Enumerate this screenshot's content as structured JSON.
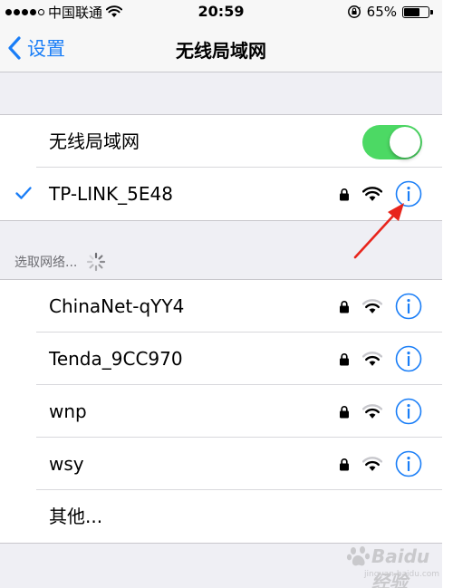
{
  "status_bar": {
    "carrier": "中国联通",
    "time": "20:59",
    "battery": "65%",
    "battery_level": 0.65,
    "signal_bars_filled": 4,
    "signal_bars_total": 5
  },
  "nav": {
    "back_label": "设置",
    "title": "无线局域网"
  },
  "wifi_toggle": {
    "label": "无线局域网",
    "on": true
  },
  "connected_network": {
    "name": "TP-LINK_5E48",
    "secured": true
  },
  "section_header": "选取网络...",
  "networks": [
    {
      "name": "ChinaNet-qYY4",
      "secured": true
    },
    {
      "name": "Tenda_9CC970",
      "secured": true
    },
    {
      "name": "wnp",
      "secured": true
    },
    {
      "name": "wsy",
      "secured": true
    }
  ],
  "other_label": "其他...",
  "colors": {
    "accent": "#1a7ef7",
    "toggle_on": "#4cd964",
    "annotation_arrow": "#e8251c"
  },
  "watermark": {
    "text": "Baidu经验",
    "url": "jingyan.baidu.com"
  }
}
